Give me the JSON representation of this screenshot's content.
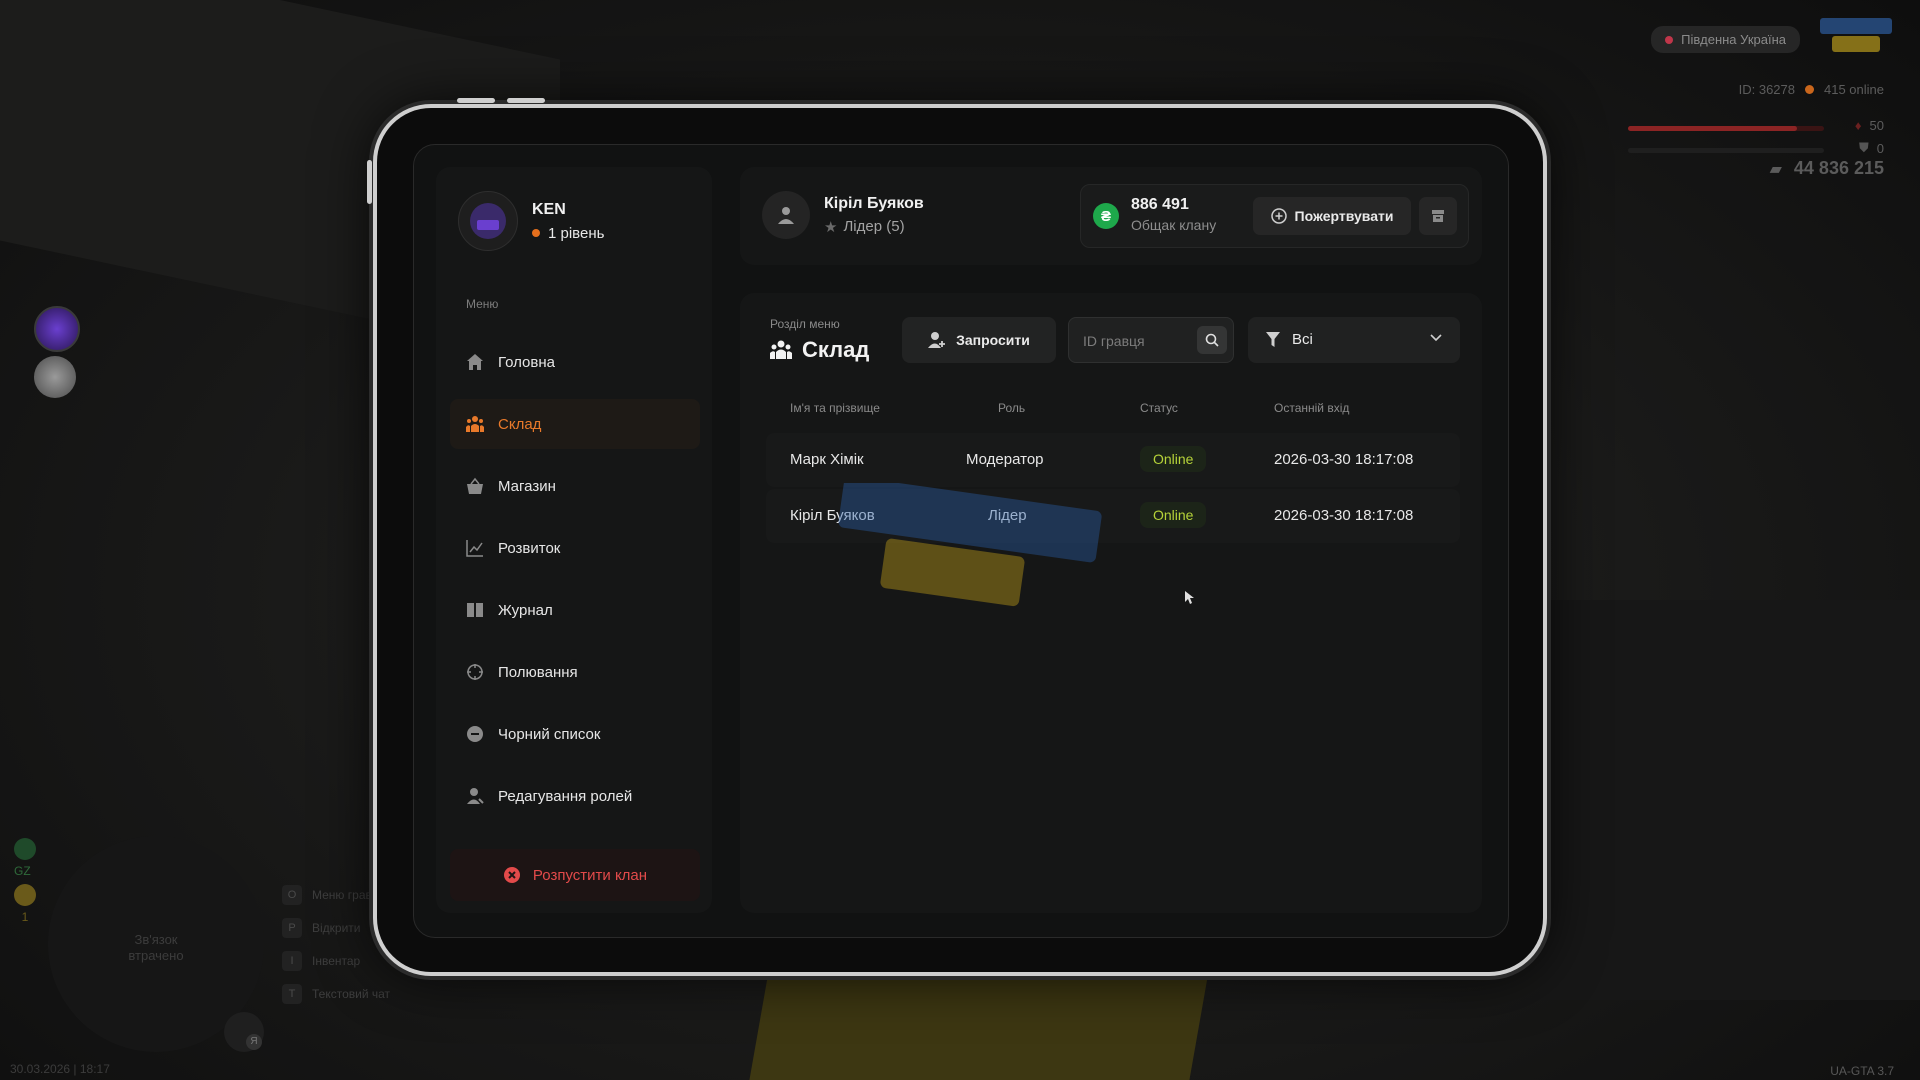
{
  "hud": {
    "region": "Південна Україна",
    "player_id": "ID: 36278",
    "online": "415 online",
    "health": "50",
    "armor": "0",
    "health_fill": 0.86,
    "money": "44 836 215",
    "date_time": "30.03.2026 | 18:17",
    "version": "UA-GTA 3.7",
    "radar_text_1": "Зв'язок",
    "radar_text_2": "втрачено",
    "gz_label": "GZ",
    "star_count": "1",
    "hotkeys": [
      {
        "key": "O",
        "label": "Меню гравця"
      },
      {
        "key": "P",
        "label": "Відкрити"
      },
      {
        "key": "I",
        "label": "Інвентар"
      },
      {
        "key": "T",
        "label": "Текстовий чат"
      }
    ],
    "mic_key": "Я",
    "colors": {
      "accent": "#e8792a",
      "online": "#b6d339",
      "danger": "#e24a4a",
      "coin": "#1ea84b"
    }
  },
  "profile": {
    "name": "KEN",
    "level": "1 рівень"
  },
  "menu": {
    "caption": "Меню",
    "items": [
      {
        "label": "Головна",
        "icon": "home-icon",
        "active": false
      },
      {
        "label": "Склад",
        "icon": "people-icon",
        "active": true
      },
      {
        "label": "Магазин",
        "icon": "basket-icon",
        "active": false
      },
      {
        "label": "Розвиток",
        "icon": "chart-icon",
        "active": false
      },
      {
        "label": "Журнал",
        "icon": "book-icon",
        "active": false
      },
      {
        "label": "Полювання",
        "icon": "crosshair-icon",
        "active": false
      },
      {
        "label": "Чорний список",
        "icon": "minus-circle-icon",
        "active": false
      },
      {
        "label": "Редагування ролей",
        "icon": "user-edit-icon",
        "active": false
      }
    ],
    "dissolve_label": "Розпустити клан"
  },
  "header": {
    "user_name": "Кірiл Буяков",
    "user_role": "Лідер (5)",
    "bank_amount": "886 491",
    "bank_caption": "Общак клану",
    "donate_label": "Пожертвувати"
  },
  "section": {
    "caption": "Розділ меню",
    "title": "Склад",
    "invite_label": "Запросити",
    "search_placeholder": "ID гравця",
    "filter_value": "Всі"
  },
  "table": {
    "columns": [
      "Ім'я та прізвище",
      "Роль",
      "Статус",
      "Останній вхід"
    ],
    "rows": [
      {
        "name": "Марк Хімік",
        "role": "Модератор",
        "status": "Online",
        "last_login": "2026-03-30 18:17:08"
      },
      {
        "name": "Кірiл Буяков",
        "role": "Лідер",
        "status": "Online",
        "last_login": "2026-03-30 18:17:08"
      }
    ]
  }
}
